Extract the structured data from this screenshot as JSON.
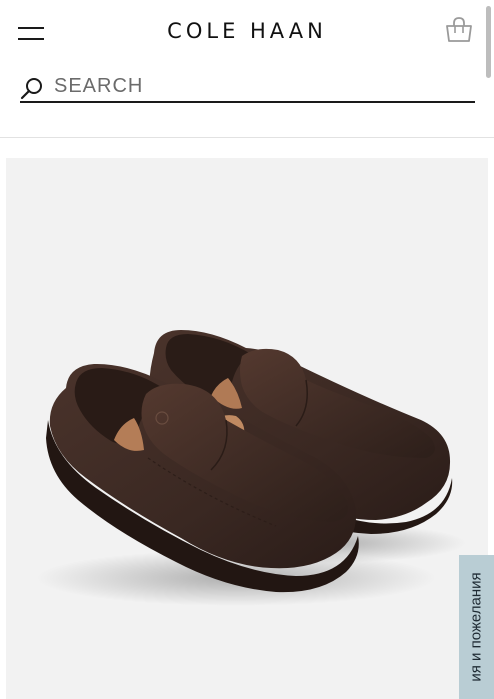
{
  "header": {
    "brand": "COLE HAAN",
    "menu_icon": "hamburger-menu-icon",
    "bag_icon": "shopping-bag-icon"
  },
  "search": {
    "icon": "search-icon",
    "placeholder": "SEARCH"
  },
  "product": {
    "image_description_icon": "loafer-shoes-image",
    "colors": {
      "background": "#f2f2f2",
      "shoe": "#3b2923"
    }
  },
  "feedback": {
    "label": "ия и пожелания",
    "background": "#b9cdd4"
  }
}
